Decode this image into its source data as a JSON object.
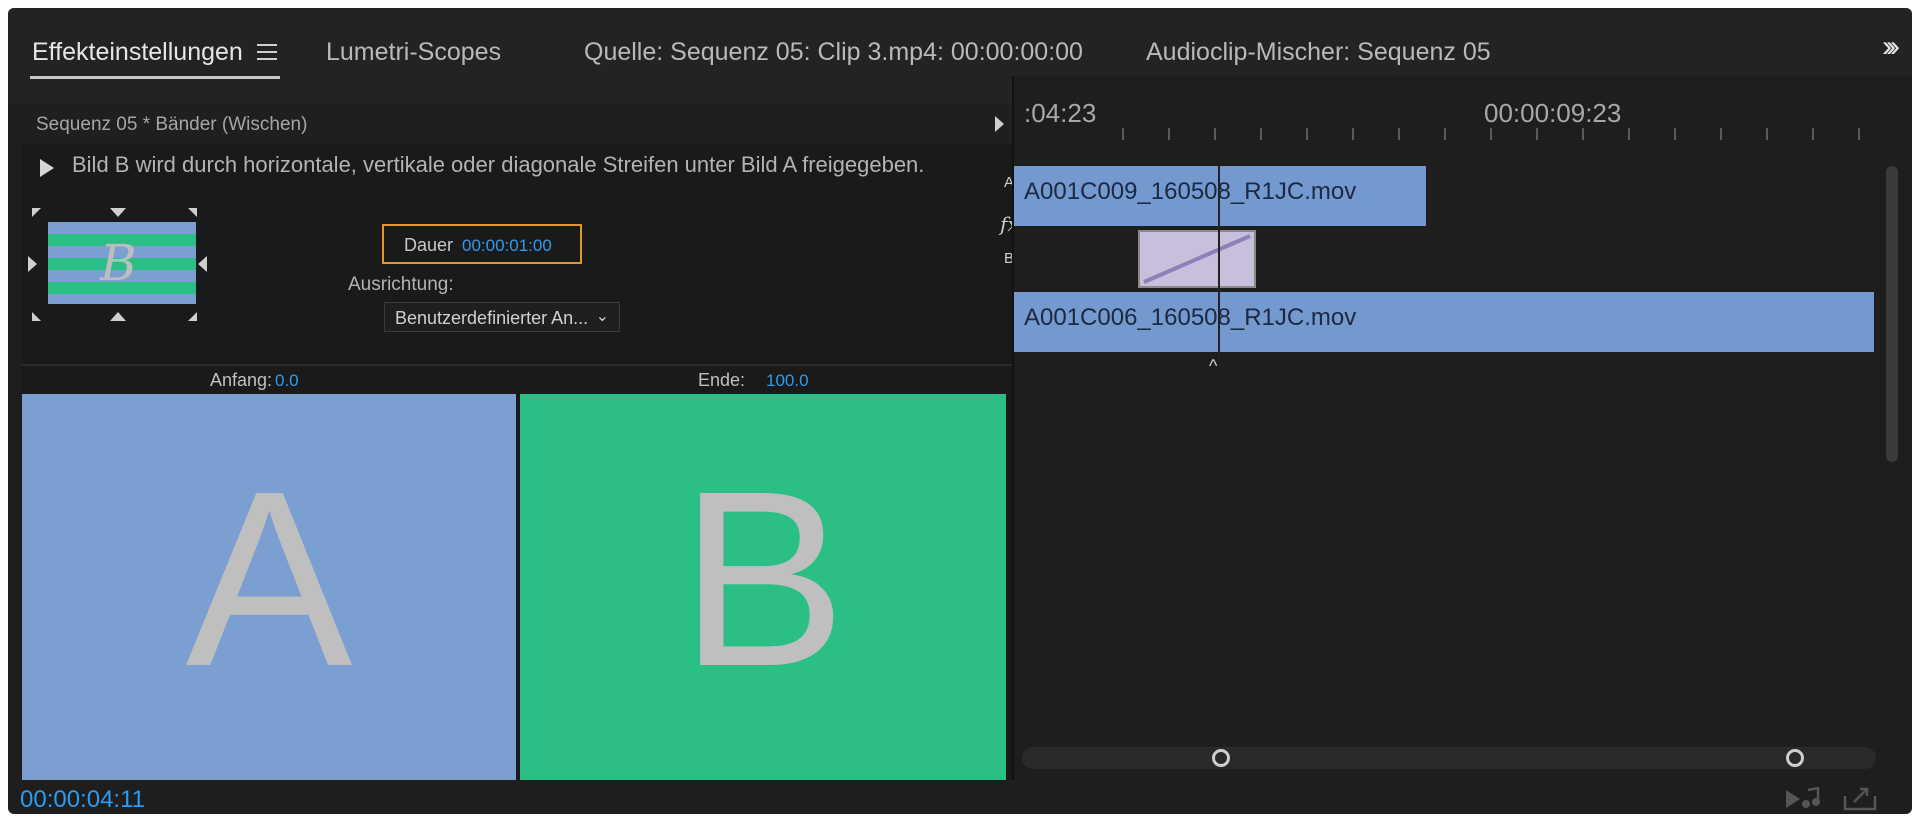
{
  "tabs": [
    {
      "label": "Effekteinstellungen",
      "active": true
    },
    {
      "label": "Lumetri-Scopes"
    },
    {
      "label": "Quelle: Sequenz 05: Clip 3.mp4: 00:00:00:00"
    },
    {
      "label": "Audioclip-Mischer: Sequenz 05"
    }
  ],
  "effect": {
    "sequence_title": "Sequenz 05 * Bänder (Wischen)",
    "description": "Bild B wird durch horizontale, vertikale oder diagonale Streifen unter Bild A freigegeben.",
    "thumbnail_letter": "B",
    "duration_label": "Dauer",
    "duration_value": "00:00:01:00",
    "alignment_label": "Ausrichtung:",
    "alignment_value": "Benutzerdefinierter An...",
    "start_label": "Anfang:",
    "start_value": "0.0",
    "end_label": "Ende:",
    "end_value": "100.0",
    "preview_a": "A",
    "preview_b": "B"
  },
  "track_labels": {
    "a": "A",
    "fx": "fx",
    "b": "B"
  },
  "timeline": {
    "time_left": ":04:23",
    "time_right": "00:00:09:23",
    "clip_top": "A001C009_160508_R1JC.mov",
    "clip_bottom": "A001C006_160508_R1JC.mov"
  },
  "current_timecode": "00:00:04:11",
  "colors": {
    "accent_blue": "#2d9bf0",
    "highlight_orange": "#e1952e",
    "clip_blue": "#7399cf",
    "preview_green": "#2bbf85",
    "transition_lavender": "#c8bfdd"
  }
}
